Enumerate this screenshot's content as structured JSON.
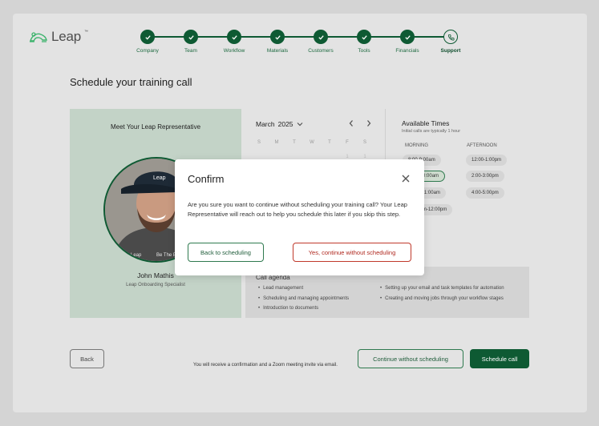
{
  "brand": {
    "name": "Leap",
    "trademark": "™",
    "accent": "#0e5a33"
  },
  "steps": [
    {
      "label": "Company",
      "state": "done"
    },
    {
      "label": "Team",
      "state": "done"
    },
    {
      "label": "Workflow",
      "state": "done"
    },
    {
      "label": "Materials",
      "state": "done"
    },
    {
      "label": "Customers",
      "state": "done"
    },
    {
      "label": "Tools",
      "state": "done"
    },
    {
      "label": "Financials",
      "state": "done"
    },
    {
      "label": "Support",
      "state": "current"
    }
  ],
  "page": {
    "title": "Schedule your training call"
  },
  "rep": {
    "heading": "Meet Your Leap Representative",
    "name": "John Mathis",
    "role": "Leap Onboarding Specialist",
    "cap_text": "Leap",
    "shirt_text_1": "Leap",
    "shirt_text_2": "Be The P"
  },
  "calendar": {
    "month": "March",
    "year": "2025",
    "weekdays": [
      "S",
      "M",
      "T",
      "W",
      "T",
      "F",
      "S"
    ],
    "prev_icon": "chevron-left-icon",
    "next_icon": "chevron-right-icon",
    "visible_dates": [
      "1",
      "1"
    ]
  },
  "times": {
    "title": "Available Times",
    "subtitle": "Initial calls are typically 1 hour",
    "morning_label": "MORNING",
    "afternoon_label": "AFTERNOON",
    "morning": [
      "9:00-10:00am",
      "10:00-11:00am",
      "11:00am-12:00pm"
    ],
    "morning_visible": [
      "8:00-9:00am",
      "9:00-10:00am",
      "10:00-11:00am",
      "11:00am-12:00pm"
    ],
    "afternoon": [
      "12:00-1:00pm",
      "2:00-3:00pm",
      "4:00-5:00pm"
    ],
    "selected": "9:00-10:00am"
  },
  "agenda": {
    "title": "Call agenda",
    "left": [
      "Lead management",
      "Scheduling and managing appointments",
      "Introduction to documents"
    ],
    "right": [
      "Setting up your email and task templates for automation",
      "Creating and moving jobs through your workflow stages"
    ]
  },
  "footer": {
    "back_label": "Back",
    "note": "You will receive a confirmation and a Zoom meeting invite via email.",
    "continue_label": "Continue without scheduling",
    "schedule_label": "Schedule call"
  },
  "modal": {
    "title": "Confirm",
    "body": "Are you sure you want to continue without scheduling your training call? Your Leap Representative will reach out to help you schedule this later if you skip this step.",
    "back_label": "Back to scheduling",
    "confirm_label": "Yes, continue without scheduling",
    "confirm_color": "#c0392b"
  }
}
